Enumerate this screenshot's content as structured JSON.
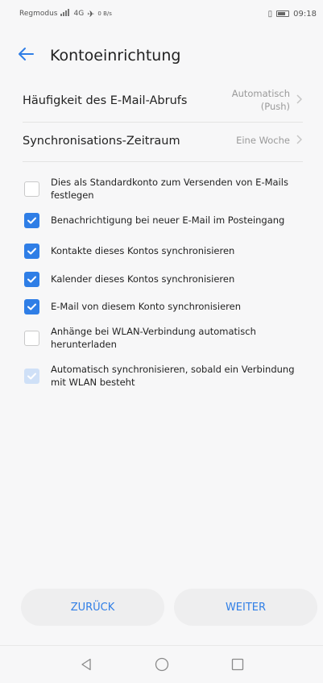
{
  "statusbar": {
    "carrier": "Regmodus",
    "network": "4G",
    "speed": "0 B/s",
    "time": "09:18"
  },
  "appbar": {
    "back_icon": "arrow-left-icon",
    "title": "Kontoeinrichtung"
  },
  "settings": [
    {
      "label": "Häufigkeit des E-Mail-Abrufs",
      "value_line1": "Automatisch",
      "value_line2": "(Push)"
    },
    {
      "label": "Synchronisations-Zeitraum",
      "value_line1": "Eine Woche",
      "value_line2": ""
    }
  ],
  "options": [
    {
      "label": "Dies als Standardkonto zum Versenden von E-Mails festlegen",
      "state": "unchecked"
    },
    {
      "label": "Benachrichtigung bei neuer E-Mail im Posteingang",
      "state": "checked"
    },
    {
      "label": "Kontakte dieses Kontos synchronisieren",
      "state": "checked"
    },
    {
      "label": "Kalender dieses Kontos synchronisieren",
      "state": "checked"
    },
    {
      "label": "E-Mail von diesem Konto synchronisieren",
      "state": "checked"
    },
    {
      "label": "Anhänge bei WLAN-Verbindung automatisch herunterladen",
      "state": "unchecked"
    },
    {
      "label": "Automatisch synchronisieren, sobald ein Verbindung mit WLAN besteht",
      "state": "disabled"
    }
  ],
  "buttons": {
    "back": "ZURÜCK",
    "next": "WEITER"
  },
  "colors": {
    "accent": "#2f7ee6",
    "background": "#f7f7f8"
  }
}
